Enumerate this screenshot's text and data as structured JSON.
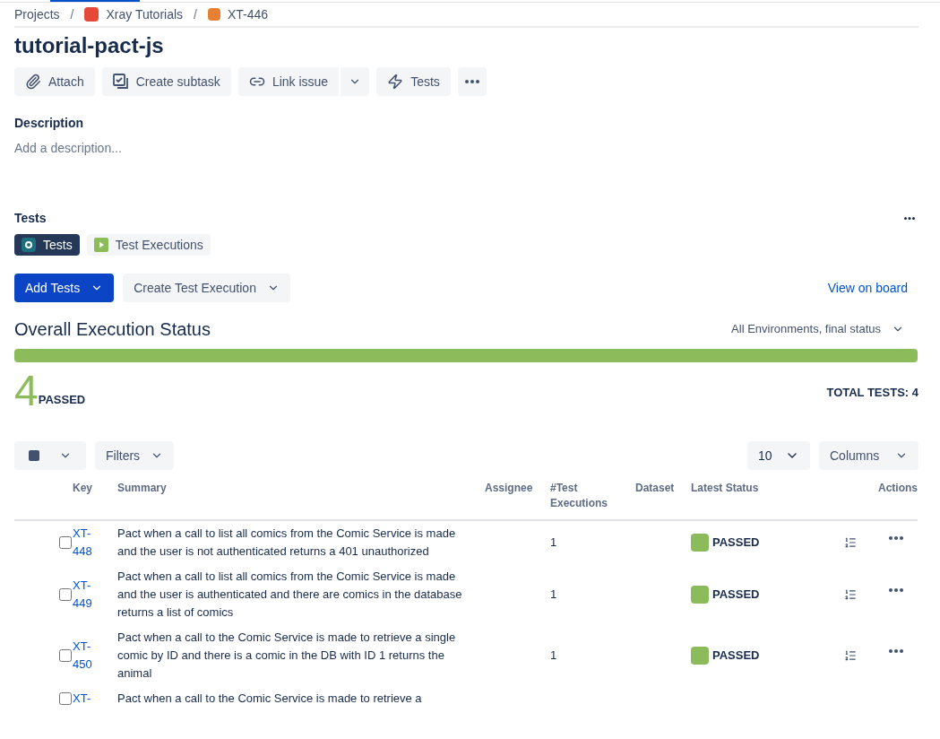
{
  "breadcrumbs": [
    {
      "label": "Projects",
      "kind": "text"
    },
    {
      "separator": "/",
      "label": "Xray Tutorials",
      "kind": "project"
    },
    {
      "separator": "/",
      "label": "XT-446",
      "kind": "issue"
    }
  ],
  "title": "tutorial-pact-js",
  "toolbar": [
    {
      "label": "Attach",
      "kind": "attach"
    },
    {
      "label": "Create subtask",
      "kind": "subtask"
    },
    {
      "label": "Link issue",
      "kind": "link"
    },
    {
      "label": "Tests",
      "kind": "tests"
    }
  ],
  "description": {
    "heading": "Description",
    "placeholder": "Add a description..."
  },
  "tests_panel": {
    "heading": "Tests",
    "tabs": [
      {
        "label": "Tests",
        "selected": true,
        "kind": "tests"
      },
      {
        "label": "Test Executions",
        "selected": false,
        "kind": "executions"
      }
    ],
    "add_button": "Add Tests",
    "create_button": "Create Test Execution",
    "board_link": "View on board",
    "status_heading": "Overall Execution Status",
    "environment": "All Environments, final status",
    "progress": {
      "level": 1
    },
    "passed_count": "4",
    "passed_label": "PASSED",
    "total": "TOTAL TESTS: 4",
    "filters_button": "Filters",
    "page_size": "10",
    "columns_button": "Columns",
    "table": {
      "columns": [
        "Key",
        "Summary",
        "Assignee",
        "#Test Executions",
        "Dataset",
        "Latest Status",
        "Actions"
      ],
      "rows": [
        {
          "checked": false,
          "key": "XT-448",
          "summary": "Pact when a call to list all comics from the Comic Service is made and the user is not authenticated returns a 401 unauthorized",
          "executions": "1",
          "status": "PASSED",
          "color": "#8bbb5b"
        },
        {
          "checked": false,
          "key": "XT-449",
          "summary": "Pact when a call to list all comics from the Comic Service is made and the user is authenticated and there are comics in the database returns a list of comics",
          "executions": "1",
          "status": "PASSED",
          "color": "#8bbb5b"
        },
        {
          "checked": false,
          "key": "XT-450",
          "summary": "Pact when a call to the Comic Service is made to retrieve a single comic by ID and there is a comic in the DB with ID 1 returns the animal",
          "executions": "1",
          "status": "PASSED",
          "color": "#8bbb5b"
        },
        {
          "checked": false,
          "key": "XT-",
          "summary": "Pact when a call to the Comic Service is made to retrieve a"
        }
      ]
    }
  }
}
